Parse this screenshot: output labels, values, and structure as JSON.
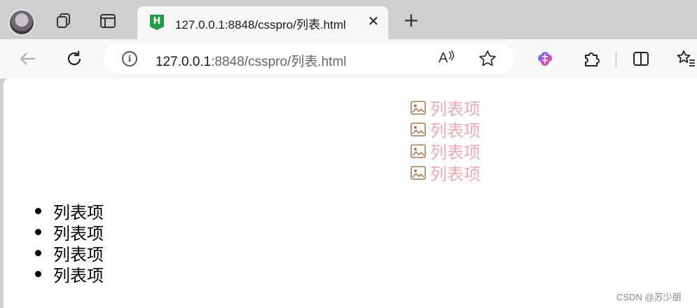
{
  "tab": {
    "title": "127.0.0.1:8848/csspro/列表.html",
    "favicon_letter": "H",
    "close_glyph": "✕"
  },
  "newtab_glyph": "+",
  "address": {
    "host": "127.0.0.1",
    "rest": ":8848/csspro/列表.html",
    "info_glyph": "i",
    "readaloud_glyph": "A"
  },
  "page": {
    "pink_list": [
      "列表项",
      "列表项",
      "列表项",
      "列表项"
    ],
    "bullet_list": [
      "列表项",
      "列表项",
      "列表项",
      "列表项"
    ]
  },
  "watermark": "CSDN @苏少朋",
  "colors": {
    "pink_text": "#f4a7b5",
    "favicon_green": "#1fa045"
  }
}
